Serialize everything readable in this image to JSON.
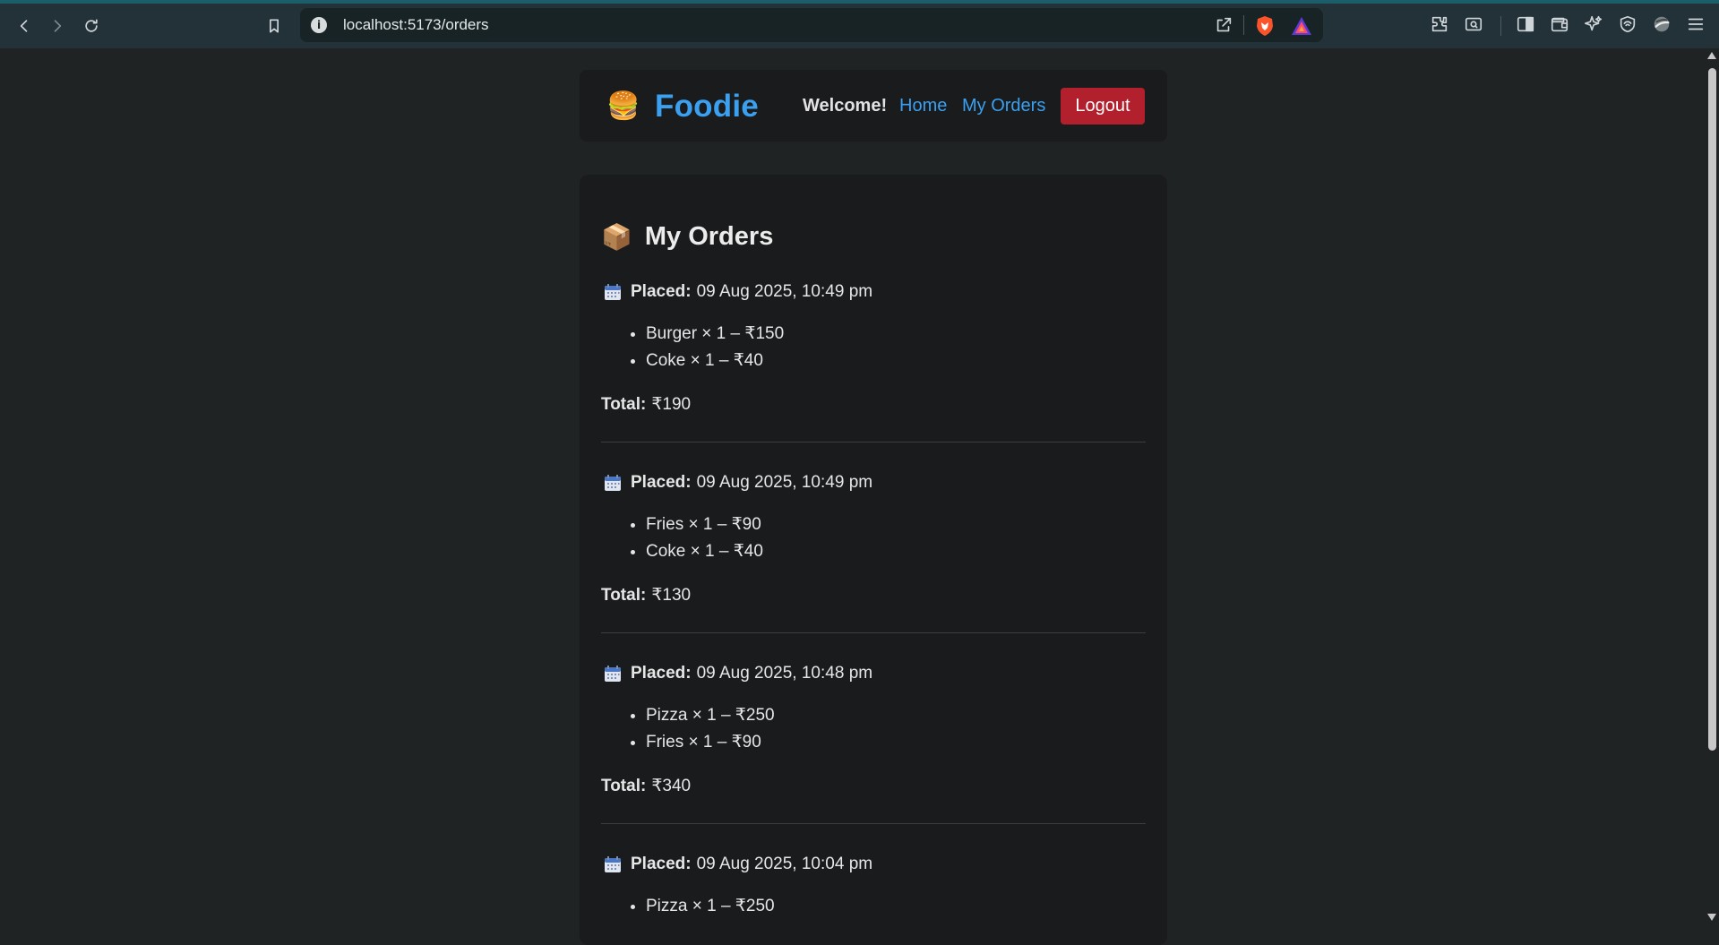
{
  "browser": {
    "url": "localhost:5173/orders"
  },
  "navbar": {
    "logo_emoji": "🍔",
    "brand": "Foodie",
    "welcome": "Welcome!",
    "home_label": "Home",
    "orders_label": "My Orders",
    "logout_label": "Logout"
  },
  "page": {
    "heading_emoji": "📦",
    "heading": "My Orders",
    "placed_label": "Placed:",
    "total_label": "Total:"
  },
  "orders": [
    {
      "placed": "09 Aug 2025, 10:49 pm",
      "items": [
        "Burger × 1 – ₹150",
        "Coke × 1 – ₹40"
      ],
      "total": "₹190"
    },
    {
      "placed": "09 Aug 2025, 10:49 pm",
      "items": [
        "Fries × 1 – ₹90",
        "Coke × 1 – ₹40"
      ],
      "total": "₹130"
    },
    {
      "placed": "09 Aug 2025, 10:48 pm",
      "items": [
        "Pizza × 1 – ₹250",
        "Fries × 1 – ₹90"
      ],
      "total": "₹340"
    },
    {
      "placed": "09 Aug 2025, 10:04 pm",
      "items": [
        "Pizza × 1 – ₹250"
      ],
      "total": ""
    }
  ],
  "colors": {
    "accent": "#3aa0ef",
    "logout": "#b21f2d",
    "background": "#1f2324",
    "card": "#1a1b1d"
  }
}
